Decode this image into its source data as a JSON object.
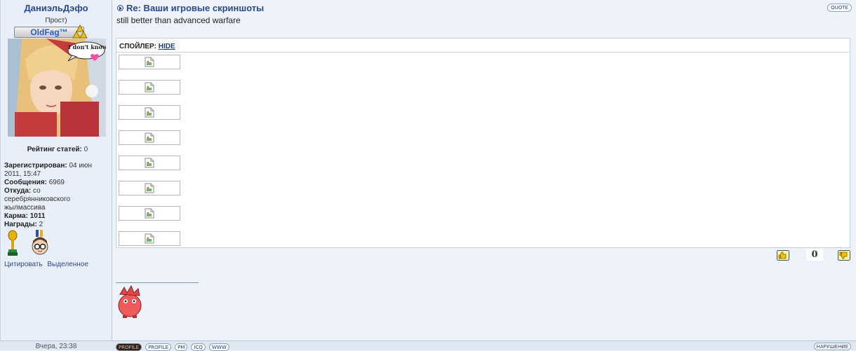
{
  "user": {
    "name": "ДаниэльДэфо",
    "rank": "Прост)",
    "badge": "OldFag™",
    "rating_label": "Рейтинг статей:",
    "rating_value": "0",
    "registered_label": "Зарегистрирован:",
    "registered_value": "04 июн 2011, 15:47",
    "posts_label": "Сообщения:",
    "posts_value": "6969",
    "from_label": "Откуда:",
    "from_value": "со серебрянниковского жылмассива",
    "karma_label": "Карма:",
    "karma_value": "1011",
    "awards_label": "Награды:",
    "awards_value": "2",
    "avatar_bubble": "I don't know"
  },
  "left_links": {
    "quote": "Цитировать",
    "selected": "Выделенное"
  },
  "post": {
    "title": "Re: Ваши игровые скриншоты",
    "quote_btn": "QUOTE",
    "message": "still better than advanced warfare",
    "spoiler_label": "СПОЙЛЕР:",
    "spoiler_toggle": "HIDE",
    "image_count": 8,
    "votes": "0"
  },
  "footer": {
    "date": "Вчера, 23:38",
    "buttons": [
      "PROFILE",
      "PROFILE",
      "PM",
      "ICQ",
      "WWW"
    ],
    "report": "НАРУШЕНИЕ"
  },
  "colors": {
    "link": "#2a4a8f",
    "background": "#eef3f9"
  }
}
